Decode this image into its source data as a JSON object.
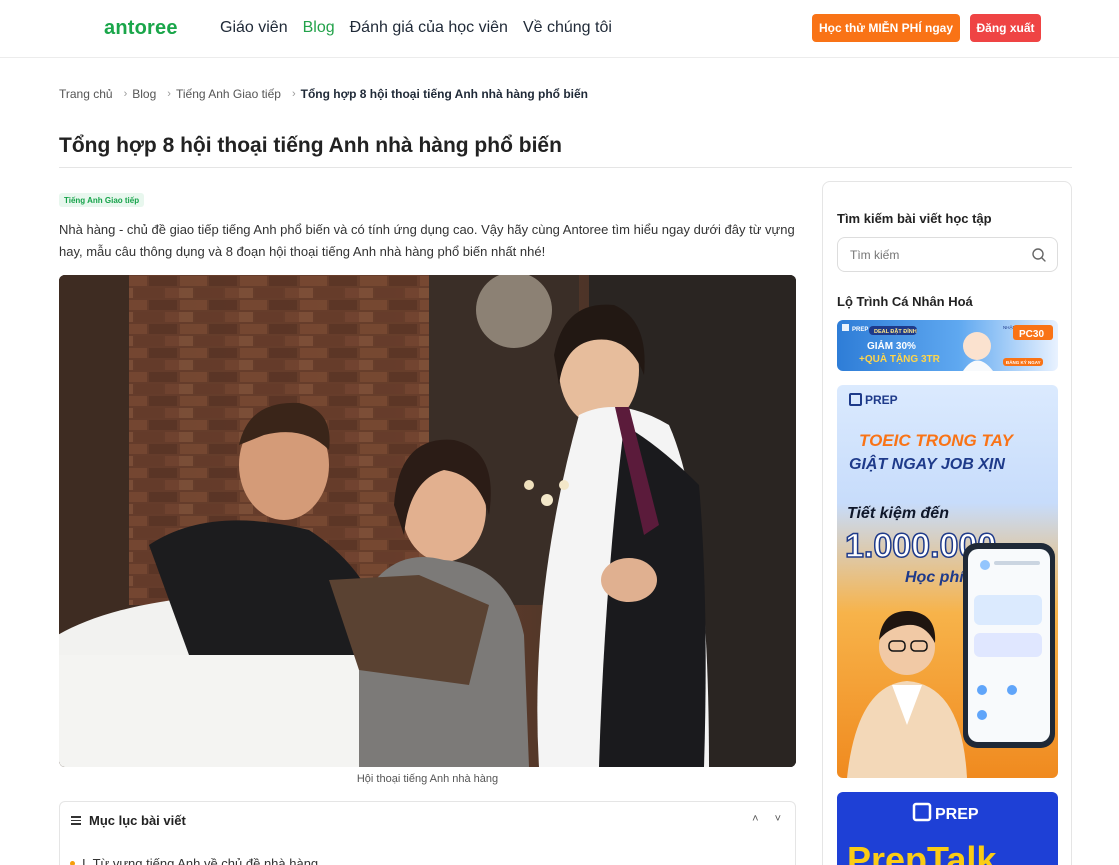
{
  "header": {
    "logo": "antoree",
    "nav": [
      "Giáo viên",
      "Blog",
      "Đánh giá của học viên",
      "Về chúng tôi"
    ],
    "trial_button": "Học thử MIỄN PHÍ ngay",
    "logout_button": "Đăng xuất"
  },
  "breadcrumb": {
    "items": [
      "Trang chủ",
      "Blog",
      "Tiếng Anh Giao tiếp"
    ],
    "current": "Tổng hợp 8 hội thoại tiếng Anh nhà hàng phổ biến"
  },
  "article": {
    "title": "Tổng hợp 8 hội thoại tiếng Anh nhà hàng phổ biến",
    "tag": "Tiếng Anh Giao tiếp",
    "intro": "Nhà hàng - chủ đề giao tiếp tiếng Anh phổ biến và có tính ứng dụng cao. Vậy hãy cùng Antoree tìm hiểu ngay dưới đây từ vựng hay, mẫu câu thông dụng và 8 đoạn hội thoại tiếng Anh nhà hàng phổ biến nhất nhé!",
    "image_caption": "Hội thoại tiếng Anh nhà hàng",
    "toc_title": "Mục lục bài viết",
    "toc_first_item": "I. Từ vựng tiếng Anh về chủ đề nhà hàng"
  },
  "sidebar": {
    "search_title": "Tìm kiếm bài viết học tập",
    "search_placeholder": "Tìm kiếm",
    "route_title": "Lộ Trình Cá Nhân Hoá",
    "ad1": {
      "brand": "PREP",
      "deal": "DEAL ĐẶT ĐỈNH",
      "line1": "GIẢM 30%",
      "line2": "+QUÀ TẶNG 3TR",
      "code_label": "NHẬP CODE",
      "code": "PC30",
      "cta": "ĐĂNG KÝ NGAY"
    },
    "ad2": {
      "brand": "PREP",
      "line1": "TOEIC TRONG TAY",
      "line2": "GIẬT NGAY JOB XỊN",
      "save_label": "Tiết kiệm đến",
      "amount": "1.000.000",
      "fee": "Học phí"
    },
    "ad3": {
      "brand": "PREP",
      "product": "PrepTalk"
    }
  }
}
